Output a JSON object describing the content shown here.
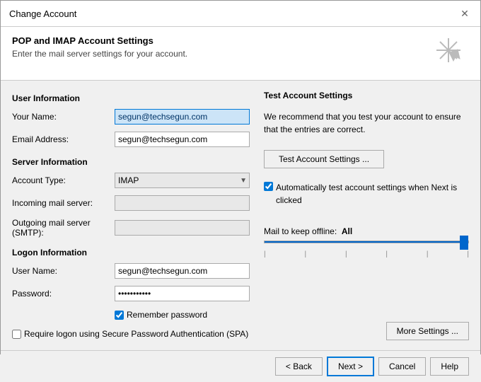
{
  "dialog": {
    "title": "Change Account",
    "close_label": "✕"
  },
  "header": {
    "title": "POP and IMAP Account Settings",
    "subtitle": "Enter the mail server settings for your account."
  },
  "left": {
    "user_info_title": "User Information",
    "your_name_label": "Your Name:",
    "your_name_value": "segun@techsegun.com",
    "email_address_label": "Email Address:",
    "email_address_value": "segun@techsegun.com",
    "server_info_title": "Server Information",
    "account_type_label": "Account Type:",
    "account_type_value": "IMAP",
    "incoming_label": "Incoming mail server:",
    "incoming_value": "",
    "outgoing_label": "Outgoing mail server (SMTP):",
    "outgoing_value": "",
    "logon_info_title": "Logon Information",
    "username_label": "User Name:",
    "username_value": "segun@techsegun.com",
    "password_label": "Password:",
    "password_value": "••••••••",
    "remember_label": "Remember password",
    "spa_label": "Require logon using Secure Password Authentication (SPA)"
  },
  "right": {
    "title": "Test Account Settings",
    "description": "We recommend that you test your account to ensure that the entries are correct.",
    "test_btn_label": "Test Account Settings ...",
    "auto_test_label": "Automatically test account settings when Next is clicked",
    "mail_offline_label": "Mail to keep offline:",
    "mail_offline_value": "All",
    "more_settings_label": "More Settings ..."
  },
  "footer": {
    "back_label": "< Back",
    "next_label": "Next >",
    "cancel_label": "Cancel",
    "help_label": "Help"
  }
}
